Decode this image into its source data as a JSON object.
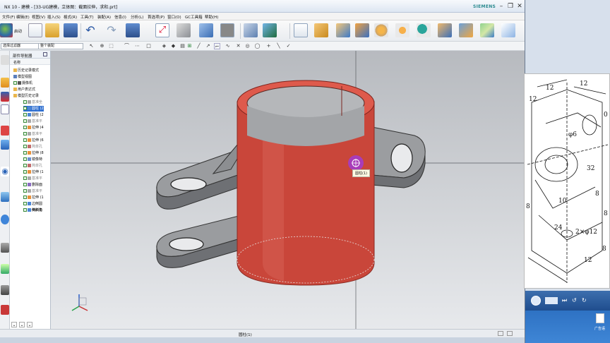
{
  "window": {
    "title": "NX 10 - 建模 - [33-UG建模，立体图：截面拉伸，求和.prt]",
    "brand": "SIEMENS",
    "controls": [
      "–",
      "❐",
      "✕"
    ]
  },
  "menu": [
    "文件(F)",
    "编辑(E)",
    "视图(V)",
    "插入(S)",
    "格式(R)",
    "工具(T)",
    "装配(A)",
    "信息(I)",
    "分析(L)",
    "首选项(P)",
    "窗口(O)",
    "GC工具箱",
    "帮助(H)"
  ],
  "ribbon": {
    "start_label": "启动"
  },
  "toolbar2": {
    "filter_value": "选择过滤器",
    "scope_value": "整个装配"
  },
  "nav": {
    "title": "部件导航器",
    "column_header": "名称",
    "nodes": [
      {
        "label": "历史记录模式"
      },
      {
        "label": "模型视图"
      },
      {
        "label": "摄像机"
      },
      {
        "label": "用户表达式"
      },
      {
        "label": "模型历史记录"
      },
      {
        "label": "基准坐"
      },
      {
        "label": "圆柱 (2"
      },
      {
        "label": "圆柱 (2"
      },
      {
        "label": "基准平"
      },
      {
        "label": "拉伸 (4"
      },
      {
        "label": "基准平"
      },
      {
        "label": "拉伸 (6"
      },
      {
        "label": "简单孔"
      },
      {
        "label": "拉伸 (8"
      },
      {
        "label": "镜像特"
      },
      {
        "label": "简单孔"
      },
      {
        "label": "拉伸 (1"
      },
      {
        "label": "基准平"
      },
      {
        "label": "删除面"
      },
      {
        "label": "基准平"
      },
      {
        "label": "拉伸 (1"
      },
      {
        "label": "边倒圆"
      },
      {
        "label": "倒斜角"
      }
    ]
  },
  "viewport": {
    "tooltip": "圆柱(1)"
  },
  "status": {
    "center_text": "圆柱(1)"
  },
  "colors": {
    "highlight": "#d24b3e",
    "part": "#8d8f92",
    "accent_purple": "#a23bd0"
  },
  "drawing": {
    "dims": [
      "12",
      "12",
      "12",
      "0",
      "φ6",
      "32",
      "8",
      "8",
      "8",
      "10",
      "24",
      "2×φ12",
      "12",
      "8"
    ]
  },
  "desktop": {
    "icon_label": "广告语"
  }
}
